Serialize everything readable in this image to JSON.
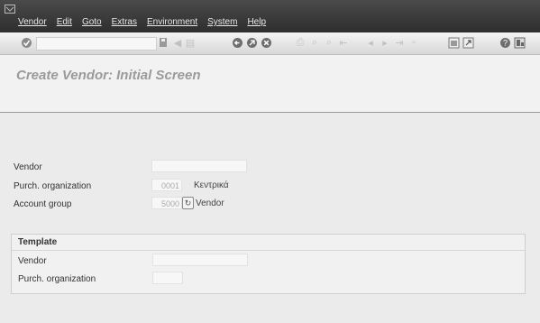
{
  "menubar": {
    "items": [
      "Vendor",
      "Edit",
      "Goto",
      "Extras",
      "Environment",
      "System",
      "Help"
    ]
  },
  "toolbar": {
    "icons": [
      "enter-icon",
      "save-icon",
      "back-icon",
      "exit-icon",
      "cancel-icon",
      "print-icon",
      "find-icon",
      "create-session-icon",
      "shortcut-icon",
      "help-icon",
      "layout-icon"
    ]
  },
  "title": "Create Vendor: Initial Screen",
  "form": {
    "vendor_label": "Vendor",
    "vendor_value": "",
    "purch_org_label": "Purch. organization",
    "purch_org_value": "0001",
    "purch_org_text": "Κεντρικά",
    "account_group_label": "Account group",
    "account_group_value": "5000",
    "account_group_text": "Vendor"
  },
  "template": {
    "title": "Template",
    "vendor_label": "Vendor",
    "vendor_value": "",
    "purch_org_label": "Purch. organization",
    "purch_org_value": ""
  }
}
